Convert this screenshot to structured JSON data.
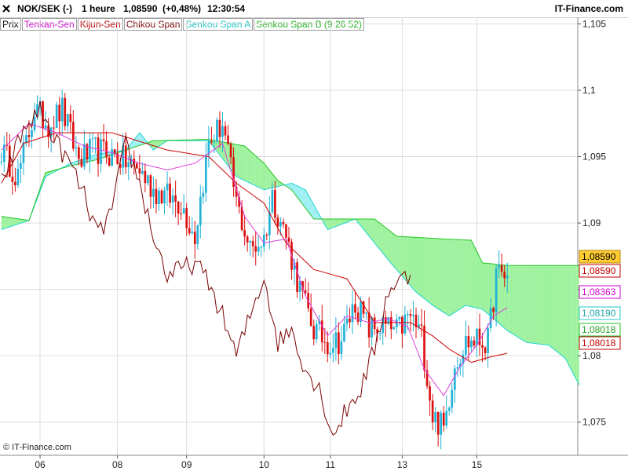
{
  "header": {
    "symbol": "NOK/SEK (-)",
    "timeframe": "1 heure",
    "last_price": "1,08590",
    "change": "(+0,48%)",
    "time": "12:30:54",
    "brand": "IT-Finance.com"
  },
  "legend": {
    "items": [
      {
        "label": "Prix",
        "color": "#000000"
      },
      {
        "label": "Tenkan-Sen",
        "color": "#cc00cc"
      },
      {
        "label": "Kijun-Sen",
        "color": "#c00000"
      },
      {
        "label": "Chikou Span",
        "color": "#7a0000"
      },
      {
        "label": "Senkou Span A",
        "color": "#22d6d6"
      },
      {
        "label": "Senkou Span B (9 26 52)",
        "color": "#22c422"
      }
    ]
  },
  "copyright": "© IT-Finance.com",
  "colors": {
    "bull_candle": "#22b2d8",
    "bear_candle": "#dd1010",
    "tenkan": "#e040e0",
    "kijun": "#cc0000",
    "chikou": "#7a0000",
    "span_a": "#22d6d6",
    "span_b": "#22c422",
    "cloud_bull": "#9ff0f3",
    "cloud_bear": "#9ef29e",
    "grid": "#dcdcdc"
  },
  "chart_data": {
    "type": "candlestick",
    "title": "NOK/SEK (-) 1 heure",
    "ylim": [
      1.0725,
      1.1055
    ],
    "y_ticks": [
      "1,105",
      "1,1",
      "1,095",
      "1,09",
      "1,085",
      "1,08",
      "1,075"
    ],
    "y_tick_values": [
      1.105,
      1.1,
      1.095,
      1.09,
      1.085,
      1.08,
      1.075
    ],
    "x_ticks": [
      "06",
      "08",
      "09",
      "10",
      "11",
      "13",
      "15"
    ],
    "x_tick_index": [
      14,
      42,
      67,
      95,
      119,
      145,
      172
    ],
    "n_bars": 184,
    "projection_bars": 26,
    "price_labels": [
      {
        "text": "1,08590",
        "value": 1.0859,
        "series": "price_last"
      },
      {
        "text": "1,08590",
        "value": 1.0856,
        "series": "kijun_a"
      },
      {
        "text": "1,08363",
        "value": 1.08363,
        "series": "tenkan"
      },
      {
        "text": "1,08190",
        "value": 1.0819,
        "series": "span_a"
      },
      {
        "text": "1,08018",
        "value": 1.08018,
        "series": "span_b"
      },
      {
        "text": "1,08018",
        "value": 1.07992,
        "series": "kijun"
      }
    ],
    "close_keypoints": [
      [
        0,
        1.0955
      ],
      [
        6,
        1.0935
      ],
      [
        12,
        1.0985
      ],
      [
        17,
        1.0975
      ],
      [
        22,
        1.0985
      ],
      [
        28,
        1.0948
      ],
      [
        34,
        1.0955
      ],
      [
        42,
        1.095
      ],
      [
        50,
        1.094
      ],
      [
        55,
        1.0925
      ],
      [
        60,
        1.092
      ],
      [
        65,
        1.0915
      ],
      [
        70,
        1.089
      ],
      [
        75,
        1.096
      ],
      [
        80,
        1.0975
      ],
      [
        85,
        1.0915
      ],
      [
        90,
        1.088
      ],
      [
        95,
        1.0888
      ],
      [
        98,
        1.092
      ],
      [
        103,
        1.089
      ],
      [
        108,
        1.085
      ],
      [
        113,
        1.082
      ],
      [
        118,
        1.081
      ],
      [
        123,
        1.0812
      ],
      [
        128,
        1.084
      ],
      [
        133,
        1.082
      ],
      [
        138,
        1.0822
      ],
      [
        143,
        1.0818
      ],
      [
        148,
        1.083
      ],
      [
        152,
        1.0815
      ],
      [
        156,
        1.0755
      ],
      [
        160,
        1.0745
      ],
      [
        164,
        1.0795
      ],
      [
        168,
        1.081
      ],
      [
        172,
        1.0812
      ],
      [
        176,
        1.081
      ],
      [
        179,
        1.086
      ],
      [
        183,
        1.086
      ]
    ],
    "tenkan_keypoints": [
      [
        0,
        1.0955
      ],
      [
        10,
        1.0975
      ],
      [
        20,
        1.0968
      ],
      [
        30,
        1.0958
      ],
      [
        40,
        1.0953
      ],
      [
        50,
        1.0945
      ],
      [
        60,
        1.094
      ],
      [
        70,
        1.0945
      ],
      [
        80,
        1.096
      ],
      [
        88,
        1.0905
      ],
      [
        95,
        1.0885
      ],
      [
        103,
        1.0888
      ],
      [
        110,
        1.0845
      ],
      [
        118,
        1.0815
      ],
      [
        125,
        1.083
      ],
      [
        133,
        1.0825
      ],
      [
        140,
        1.0828
      ],
      [
        147,
        1.0822
      ],
      [
        153,
        1.079
      ],
      [
        160,
        1.077
      ],
      [
        166,
        1.0792
      ],
      [
        172,
        1.0808
      ],
      [
        178,
        1.083
      ],
      [
        183,
        1.08363
      ]
    ],
    "kijun_keypoints": [
      [
        0,
        1.093
      ],
      [
        8,
        1.096
      ],
      [
        20,
        1.0968
      ],
      [
        40,
        1.0968
      ],
      [
        60,
        1.0955
      ],
      [
        75,
        1.095
      ],
      [
        85,
        1.093
      ],
      [
        95,
        1.0915
      ],
      [
        103,
        1.0885
      ],
      [
        113,
        1.0865
      ],
      [
        125,
        1.0858
      ],
      [
        135,
        1.0825
      ],
      [
        148,
        1.0825
      ],
      [
        156,
        1.0815
      ],
      [
        162,
        1.0805
      ],
      [
        170,
        1.0795
      ],
      [
        177,
        1.07992
      ],
      [
        183,
        1.08018
      ]
    ],
    "chikou_keypoints": [
      [
        0,
        1.093
      ],
      [
        8,
        1.097
      ],
      [
        14,
        1.0985
      ],
      [
        20,
        1.096
      ],
      [
        26,
        1.094
      ],
      [
        30,
        1.092
      ],
      [
        35,
        1.089
      ],
      [
        40,
        1.091
      ],
      [
        45,
        1.096
      ],
      [
        50,
        1.093
      ],
      [
        55,
        1.089
      ],
      [
        60,
        1.086
      ],
      [
        65,
        1.0865
      ],
      [
        70,
        1.087
      ],
      [
        75,
        1.0855
      ],
      [
        80,
        1.083
      ],
      [
        85,
        1.08
      ],
      [
        90,
        1.083
      ],
      [
        95,
        1.086
      ],
      [
        100,
        1.081
      ],
      [
        105,
        1.082
      ],
      [
        110,
        1.079
      ],
      [
        115,
        1.0775
      ],
      [
        120,
        1.074
      ],
      [
        125,
        1.076
      ],
      [
        130,
        1.0775
      ],
      [
        135,
        1.0805
      ],
      [
        140,
        1.085
      ],
      [
        145,
        1.0858
      ],
      [
        148,
        1.086
      ]
    ],
    "span_a_keypoints": [
      [
        0,
        1.0895
      ],
      [
        10,
        1.0902
      ],
      [
        16,
        1.0935
      ],
      [
        25,
        1.0945
      ],
      [
        35,
        1.0952
      ],
      [
        45,
        1.0955
      ],
      [
        50,
        1.0968
      ],
      [
        55,
        1.0955
      ],
      [
        60,
        1.0962
      ],
      [
        75,
        1.0962
      ],
      [
        85,
        1.0935
      ],
      [
        95,
        1.0925
      ],
      [
        105,
        1.093
      ],
      [
        110,
        1.0925
      ],
      [
        118,
        1.0895
      ],
      [
        128,
        1.0903
      ],
      [
        135,
        1.0885
      ],
      [
        140,
        1.0872
      ],
      [
        145,
        1.086
      ],
      [
        150,
        1.0848
      ],
      [
        156,
        1.0838
      ],
      [
        162,
        1.083
      ],
      [
        168,
        1.0838
      ],
      [
        174,
        1.0835
      ],
      [
        178,
        1.0828
      ],
      [
        183,
        1.0819
      ],
      [
        190,
        1.081
      ],
      [
        198,
        1.0808
      ],
      [
        204,
        1.0798
      ],
      [
        209,
        1.0778
      ]
    ],
    "span_b_keypoints": [
      [
        0,
        1.0905
      ],
      [
        10,
        1.0902
      ],
      [
        16,
        1.0938
      ],
      [
        25,
        1.0943
      ],
      [
        35,
        1.0948
      ],
      [
        45,
        1.0955
      ],
      [
        55,
        1.0962
      ],
      [
        75,
        1.0963
      ],
      [
        88,
        1.0958
      ],
      [
        95,
        1.0945
      ],
      [
        100,
        1.0932
      ],
      [
        105,
        1.0925
      ],
      [
        113,
        1.0903
      ],
      [
        135,
        1.0903
      ],
      [
        143,
        1.089
      ],
      [
        160,
        1.0888
      ],
      [
        170,
        1.0887
      ],
      [
        174,
        1.087
      ],
      [
        183,
        1.0868
      ],
      [
        209,
        1.0868
      ]
    ]
  }
}
